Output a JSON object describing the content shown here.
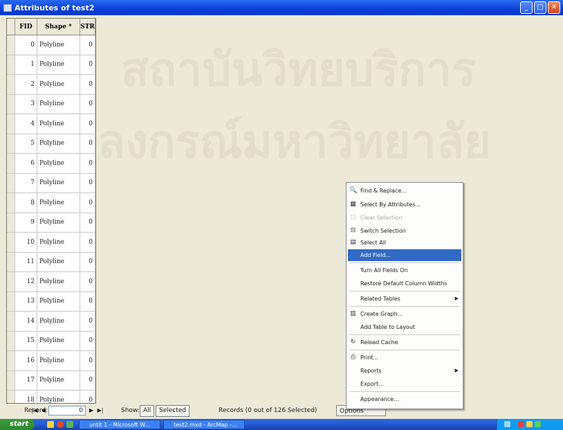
{
  "window": {
    "title": "Attributes of test2"
  },
  "watermark": {
    "line1": "สถาบันวิทยบริการ",
    "line2": "จุฬาลงกรณ์มหาวิทยาลัย"
  },
  "table": {
    "columns": [
      "FID",
      "Shape *",
      "STR"
    ],
    "rows": [
      [
        "0",
        "Polyline",
        "0"
      ],
      [
        "1",
        "Polyline",
        "0"
      ],
      [
        "2",
        "Polyline",
        "0"
      ],
      [
        "3",
        "Polyline",
        "0"
      ],
      [
        "4",
        "Polyline",
        "0"
      ],
      [
        "5",
        "Polyline",
        "0"
      ],
      [
        "6",
        "Polyline",
        "0"
      ],
      [
        "7",
        "Polyline",
        "0"
      ],
      [
        "8",
        "Polyline",
        "0"
      ],
      [
        "9",
        "Polyline",
        "0"
      ],
      [
        "10",
        "Polyline",
        "0"
      ],
      [
        "11",
        "Polyline",
        "0"
      ],
      [
        "12",
        "Polyline",
        "0"
      ],
      [
        "13",
        "Polyline",
        "0"
      ],
      [
        "14",
        "Polyline",
        "0"
      ],
      [
        "15",
        "Polyline",
        "0"
      ],
      [
        "16",
        "Polyline",
        "0"
      ],
      [
        "17",
        "Polyline",
        "0"
      ],
      [
        "18",
        "Polyline",
        "0"
      ]
    ]
  },
  "statusbar": {
    "record_label": "Record:",
    "record_value": "0",
    "show_label": "Show:",
    "all_label": "All",
    "selected_label": "Selected",
    "records_text": "Records (0 out of 126 Selected)",
    "options_label": "Options"
  },
  "menu": {
    "items": [
      {
        "label": "Find & Replace...",
        "icon": "binoculars-icon"
      },
      {
        "label": "Select By Attributes...",
        "icon": "select-by-attributes-icon"
      },
      {
        "label": "Clear Selection",
        "icon": "clear-selection-icon",
        "disabled": true
      },
      {
        "label": "Switch Selection",
        "icon": "switch-selection-icon"
      },
      {
        "label": "Select All",
        "icon": "select-all-icon"
      },
      {
        "label": "Add Field...",
        "highlighted": true
      },
      {
        "label": "Turn All Fields On"
      },
      {
        "label": "Restore Default Column Widths"
      },
      {
        "label": "Related Tables",
        "submenu": true
      },
      {
        "label": "Create Graph...",
        "icon": "graph-icon"
      },
      {
        "label": "Add Table to Layout"
      },
      {
        "label": "Reload Cache",
        "icon": "reload-icon"
      },
      {
        "label": "Print...",
        "icon": "printer-icon"
      },
      {
        "label": "Reports",
        "submenu": true
      },
      {
        "label": "Export..."
      },
      {
        "label": "Appearance..."
      }
    ]
  },
  "taskbar": {
    "start_label": "start",
    "tasks": [
      "untit 1 - Microsoft W...",
      "test2.mxd - ArcMap -..."
    ],
    "colors": {
      "bar": "#245edb",
      "start": "#2d8a2d",
      "tray": "#0f9bef"
    }
  },
  "colors": {
    "titlebar": "#0a3fd8",
    "window_bg": "#ece9d8",
    "menu_highlight": "#316ac5"
  }
}
